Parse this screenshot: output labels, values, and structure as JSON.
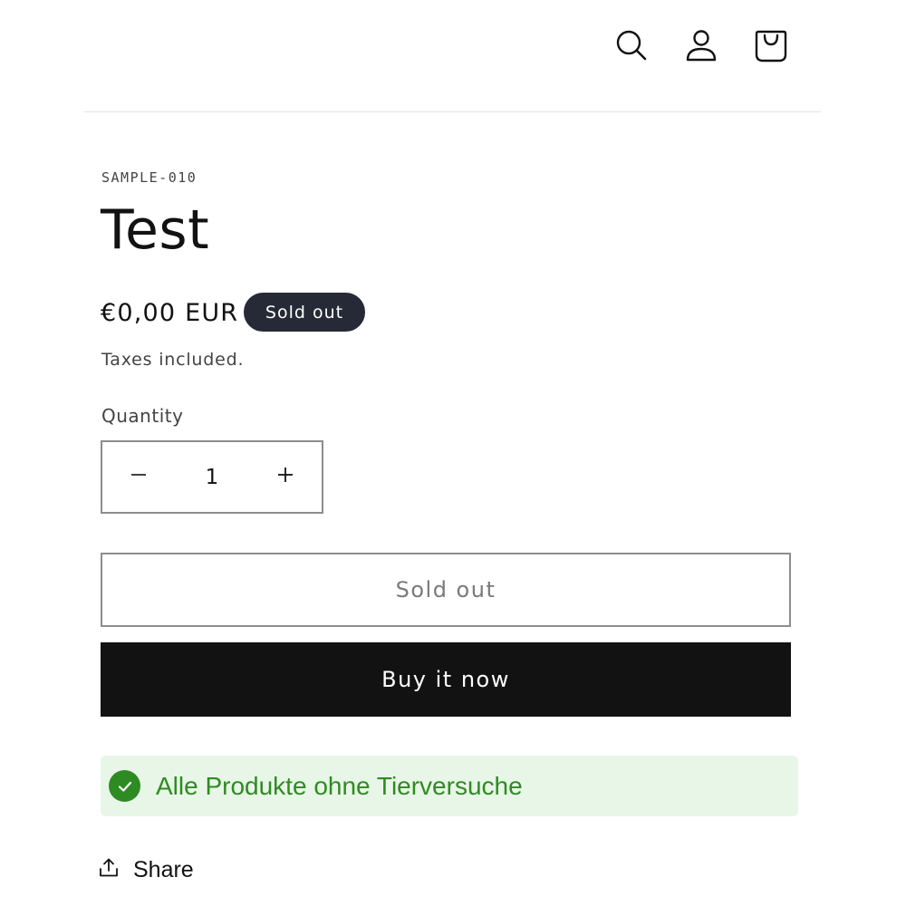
{
  "header": {
    "icons": [
      "search-icon",
      "account-icon",
      "cart-icon"
    ]
  },
  "product": {
    "sku": "SAMPLE-010",
    "title": "Test",
    "price": "€0,00 EUR",
    "badge": "Sold out",
    "tax_note": "Taxes included."
  },
  "quantity": {
    "label": "Quantity",
    "value": "1",
    "minus_symbol": "−",
    "plus_symbol": "+"
  },
  "buttons": {
    "sold_out": "Sold out",
    "buy_now": "Buy it now"
  },
  "notice": {
    "text": "Alle Produkte ohne Tierversuche",
    "color": "#2f8b22",
    "background": "#e8f6e8"
  },
  "share": {
    "label": "Share"
  }
}
